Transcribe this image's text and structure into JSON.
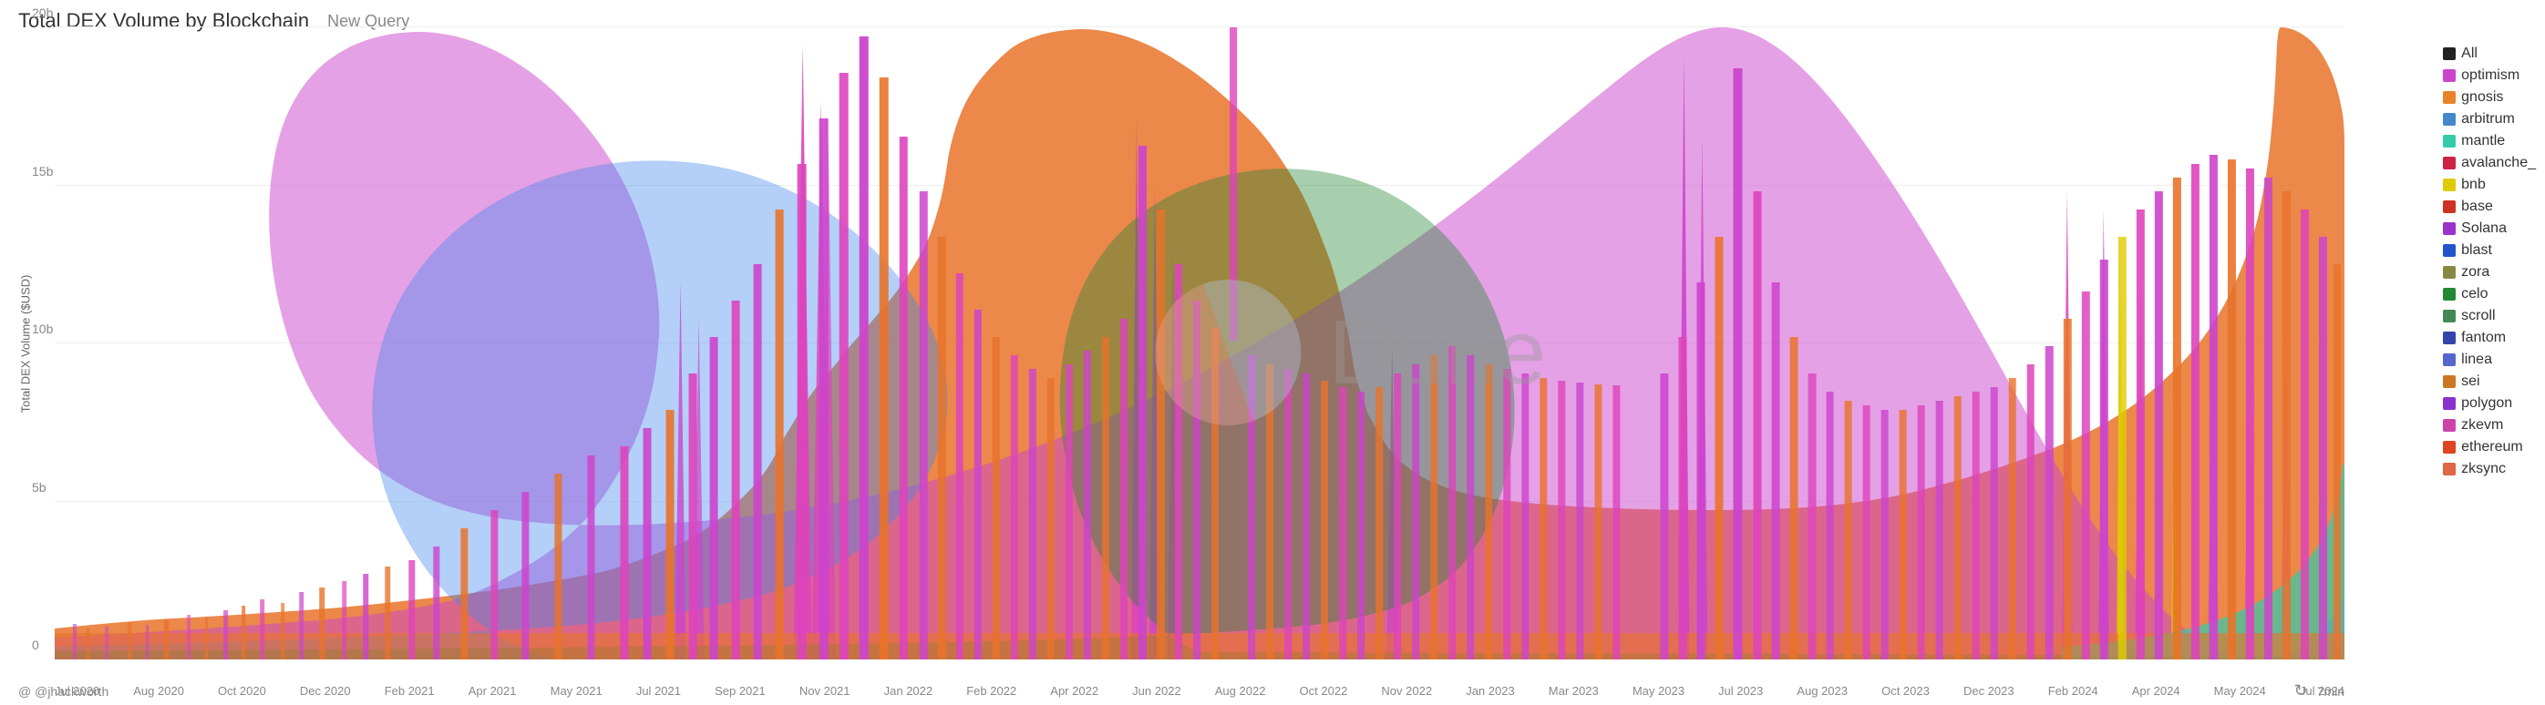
{
  "header": {
    "title": "Total DEX Volume by Blockchain",
    "new_query_label": "New Query"
  },
  "yaxis": {
    "label": "Total DEX Volume ($USD)",
    "ticks": [
      "0",
      "5b",
      "10b",
      "15b",
      "20b"
    ]
  },
  "xaxis": {
    "ticks": [
      "Jul 2020",
      "Aug 2020",
      "Oct 2020",
      "Dec 2020",
      "Feb 2021",
      "Apr 2021",
      "May 2021",
      "Jul 2021",
      "Sep 2021",
      "Nov 2021",
      "Jan 2022",
      "Feb 2022",
      "Apr 2022",
      "Jun 2022",
      "Aug 2022",
      "Oct 2022",
      "Nov 2022",
      "Jan 2023",
      "Mar 2023",
      "May 2023",
      "Jul 2023",
      "Aug 2023",
      "Oct 2023",
      "Dec 2023",
      "Feb 2024",
      "Apr 2024",
      "May 2024",
      "Jul 2024"
    ]
  },
  "watermark": {
    "text": "Dune"
  },
  "legend": {
    "items": [
      {
        "label": "All",
        "color": "#222222"
      },
      {
        "label": "optimism",
        "color": "#cc44cc"
      },
      {
        "label": "gnosis",
        "color": "#e8832a"
      },
      {
        "label": "arbitrum",
        "color": "#4488cc"
      },
      {
        "label": "mantle",
        "color": "#33ccaa"
      },
      {
        "label": "avalanche_",
        "color": "#cc2244"
      },
      {
        "label": "bnb",
        "color": "#ddcc00"
      },
      {
        "label": "base",
        "color": "#cc3322"
      },
      {
        "label": "Solana",
        "color": "#9933cc"
      },
      {
        "label": "blast",
        "color": "#2255cc"
      },
      {
        "label": "zora",
        "color": "#888844"
      },
      {
        "label": "celo",
        "color": "#228833"
      },
      {
        "label": "scroll",
        "color": "#448855"
      },
      {
        "label": "fantom",
        "color": "#3344aa"
      },
      {
        "label": "linea",
        "color": "#5566cc"
      },
      {
        "label": "sei",
        "color": "#cc7722"
      },
      {
        "label": "polygon",
        "color": "#8833cc"
      },
      {
        "label": "zkevm",
        "color": "#cc44aa"
      },
      {
        "label": "ethereum",
        "color": "#dd4422"
      },
      {
        "label": "zksync",
        "color": "#dd6644"
      }
    ]
  },
  "footer": {
    "attribution": "@ @jhackworth",
    "refresh_time": "7min"
  }
}
